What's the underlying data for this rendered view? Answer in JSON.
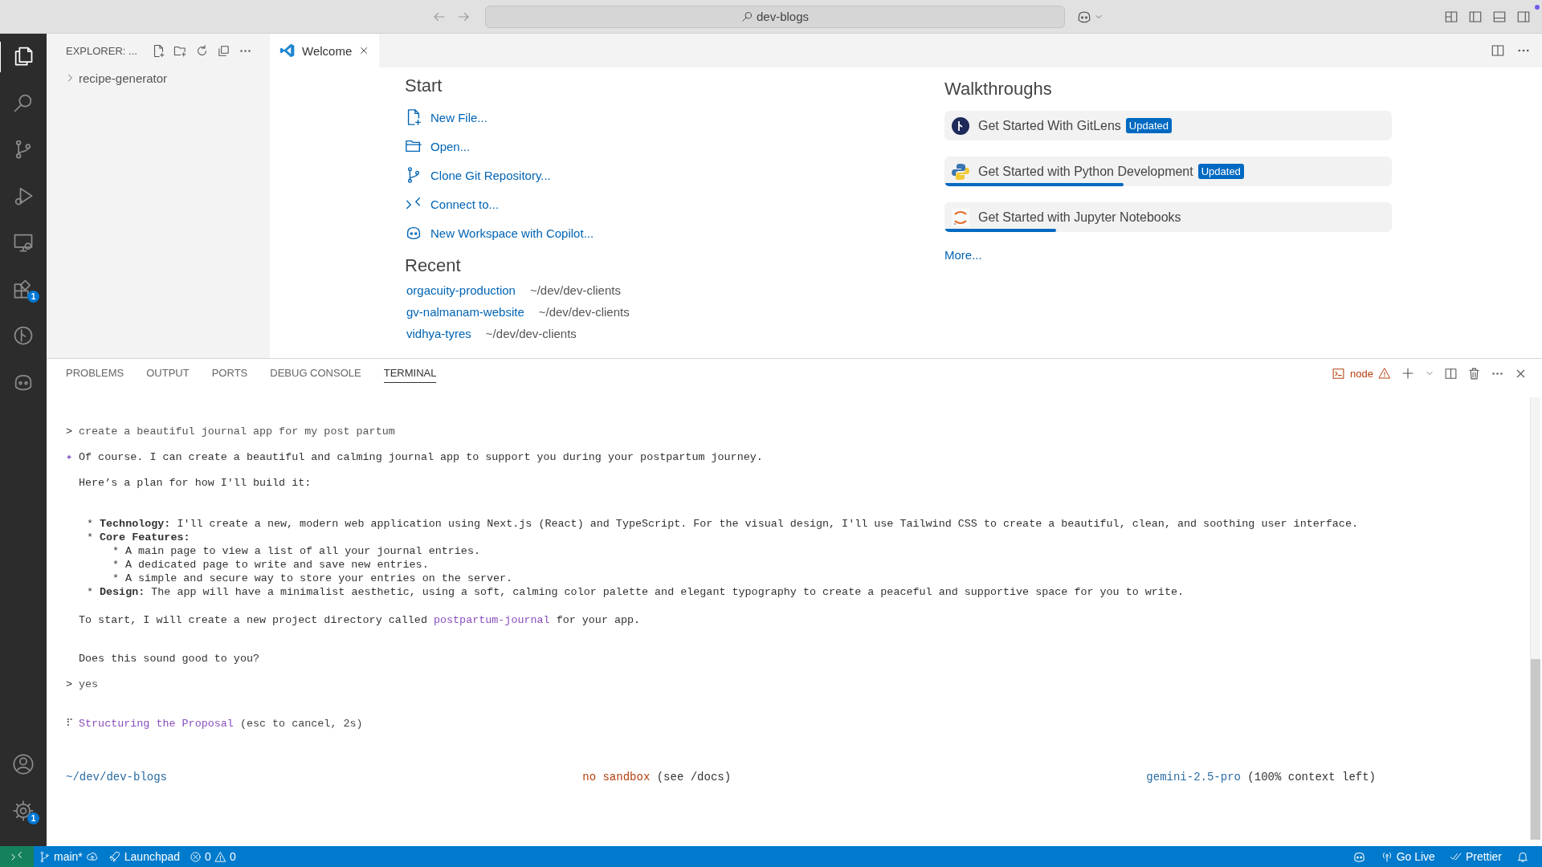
{
  "title_bar": {
    "search": "dev-blogs"
  },
  "activity_bar": {
    "items": [
      {
        "kind": "explorer",
        "selected": true
      },
      {
        "kind": "search",
        "selected": false
      },
      {
        "kind": "source-control",
        "selected": false
      },
      {
        "kind": "run",
        "selected": false
      },
      {
        "kind": "remote",
        "selected": false
      },
      {
        "kind": "extensions",
        "selected": false,
        "badge": "1"
      },
      {
        "kind": "gitlens",
        "selected": false
      },
      {
        "kind": "copilot",
        "selected": false
      }
    ],
    "bottom": [
      {
        "kind": "account"
      },
      {
        "kind": "settings",
        "badge": "1"
      }
    ]
  },
  "sidebar": {
    "title": "EXPLORER: ...",
    "tree": [
      {
        "label": "recipe-generator",
        "expanded": false
      }
    ]
  },
  "editor": {
    "tabs": [
      {
        "label": "Welcome",
        "selected": true
      }
    ]
  },
  "welcome": {
    "start_title": "Start",
    "start": [
      {
        "kind": "new-file",
        "label": "New File..."
      },
      {
        "kind": "open",
        "label": "Open..."
      },
      {
        "kind": "clone",
        "label": "Clone Git Repository..."
      },
      {
        "kind": "connect",
        "label": "Connect to..."
      },
      {
        "kind": "copilot",
        "label": "New Workspace with Copilot..."
      }
    ],
    "recent_title": "Recent",
    "recent": [
      {
        "name": "orgacuity-production",
        "path": "~/dev/dev-clients"
      },
      {
        "name": "gv-nalmanam-website",
        "path": "~/dev/dev-clients"
      },
      {
        "name": "vidhya-tyres",
        "path": "~/dev/dev-clients"
      }
    ],
    "walkthroughs_title": "Walkthroughs",
    "walkthroughs": [
      {
        "kind": "gitlens",
        "title": "Get Started With GitLens",
        "badge": "Updated"
      },
      {
        "kind": "python",
        "title": "Get Started with Python Development",
        "badge": "Updated",
        "level": 0.4
      },
      {
        "kind": "jupyter",
        "title": "Get Started with Jupyter Notebooks",
        "level": 0.25
      }
    ],
    "more": "More..."
  },
  "panel": {
    "tabs": [
      {
        "label": "PROBLEMS",
        "selected": false
      },
      {
        "label": "OUTPUT",
        "selected": false
      },
      {
        "label": "PORTS",
        "selected": false
      },
      {
        "label": "DEBUG CONSOLE",
        "selected": false
      },
      {
        "label": "TERMINAL",
        "selected": true
      }
    ],
    "terminal_name": "node",
    "lines": [
      {
        "kind": "prompt",
        "marker": ">",
        "text": "create a beautiful journal app for my post partum"
      },
      {
        "kind": "reply",
        "marker": "✦",
        "text": "Of course. I can create a beautiful and calming journal app to support you during your postpartum journey."
      },
      {
        "kind": "para",
        "text": "Here’s a plan for how I'll build it:"
      },
      {
        "kind": "bullet",
        "marker": "*",
        "text": "**Technology:** I'll create a new, modern web application using Next.js (React) and TypeScript. For the visual design, I'll use Tailwind CSS to create a beautiful, clean, and soothing user interface."
      },
      {
        "kind": "bullet",
        "marker": "*",
        "text": "**Core Features:**"
      },
      {
        "kind": "subbullet",
        "marker": "*",
        "text": "A main page to view a list of all your journal entries."
      },
      {
        "kind": "subbullet",
        "marker": "*",
        "text": "A dedicated page to write and save new entries."
      },
      {
        "kind": "subbullet",
        "marker": "*",
        "text": "A simple and secure way to store your entries on the server."
      },
      {
        "kind": "bullet",
        "marker": "*",
        "text": "**Design:** The app will have a minimalist aesthetic, using a soft, calming color palette and elegant typography to create a peaceful and supportive space for you to write."
      },
      {
        "kind": "para",
        "text": "To start, I will create a new project directory called ",
        "highlight": "postpartum-journal",
        "after": " for your app."
      },
      {
        "kind": "para",
        "text": "Does this sound good to you?"
      },
      {
        "kind": "prompt",
        "marker": ">",
        "text": "yes"
      },
      {
        "kind": "thinking",
        "marker": "⠏",
        "text": "Structuring the Proposal",
        "after": " (esc to cancel, 2s)"
      }
    ],
    "footer": {
      "cwd": "~/dev/dev-blogs",
      "sandbox": "no sandbox",
      "sandbox_hint": " (see /docs)",
      "model": "gemini-2.5-pro",
      "context": " (100% context left)"
    }
  },
  "status_bar": {
    "branch": "main*",
    "launchpad": "Launchpad",
    "errors": "0",
    "warnings": "0",
    "go_live": "Go Live",
    "prettier": "Prettier"
  }
}
